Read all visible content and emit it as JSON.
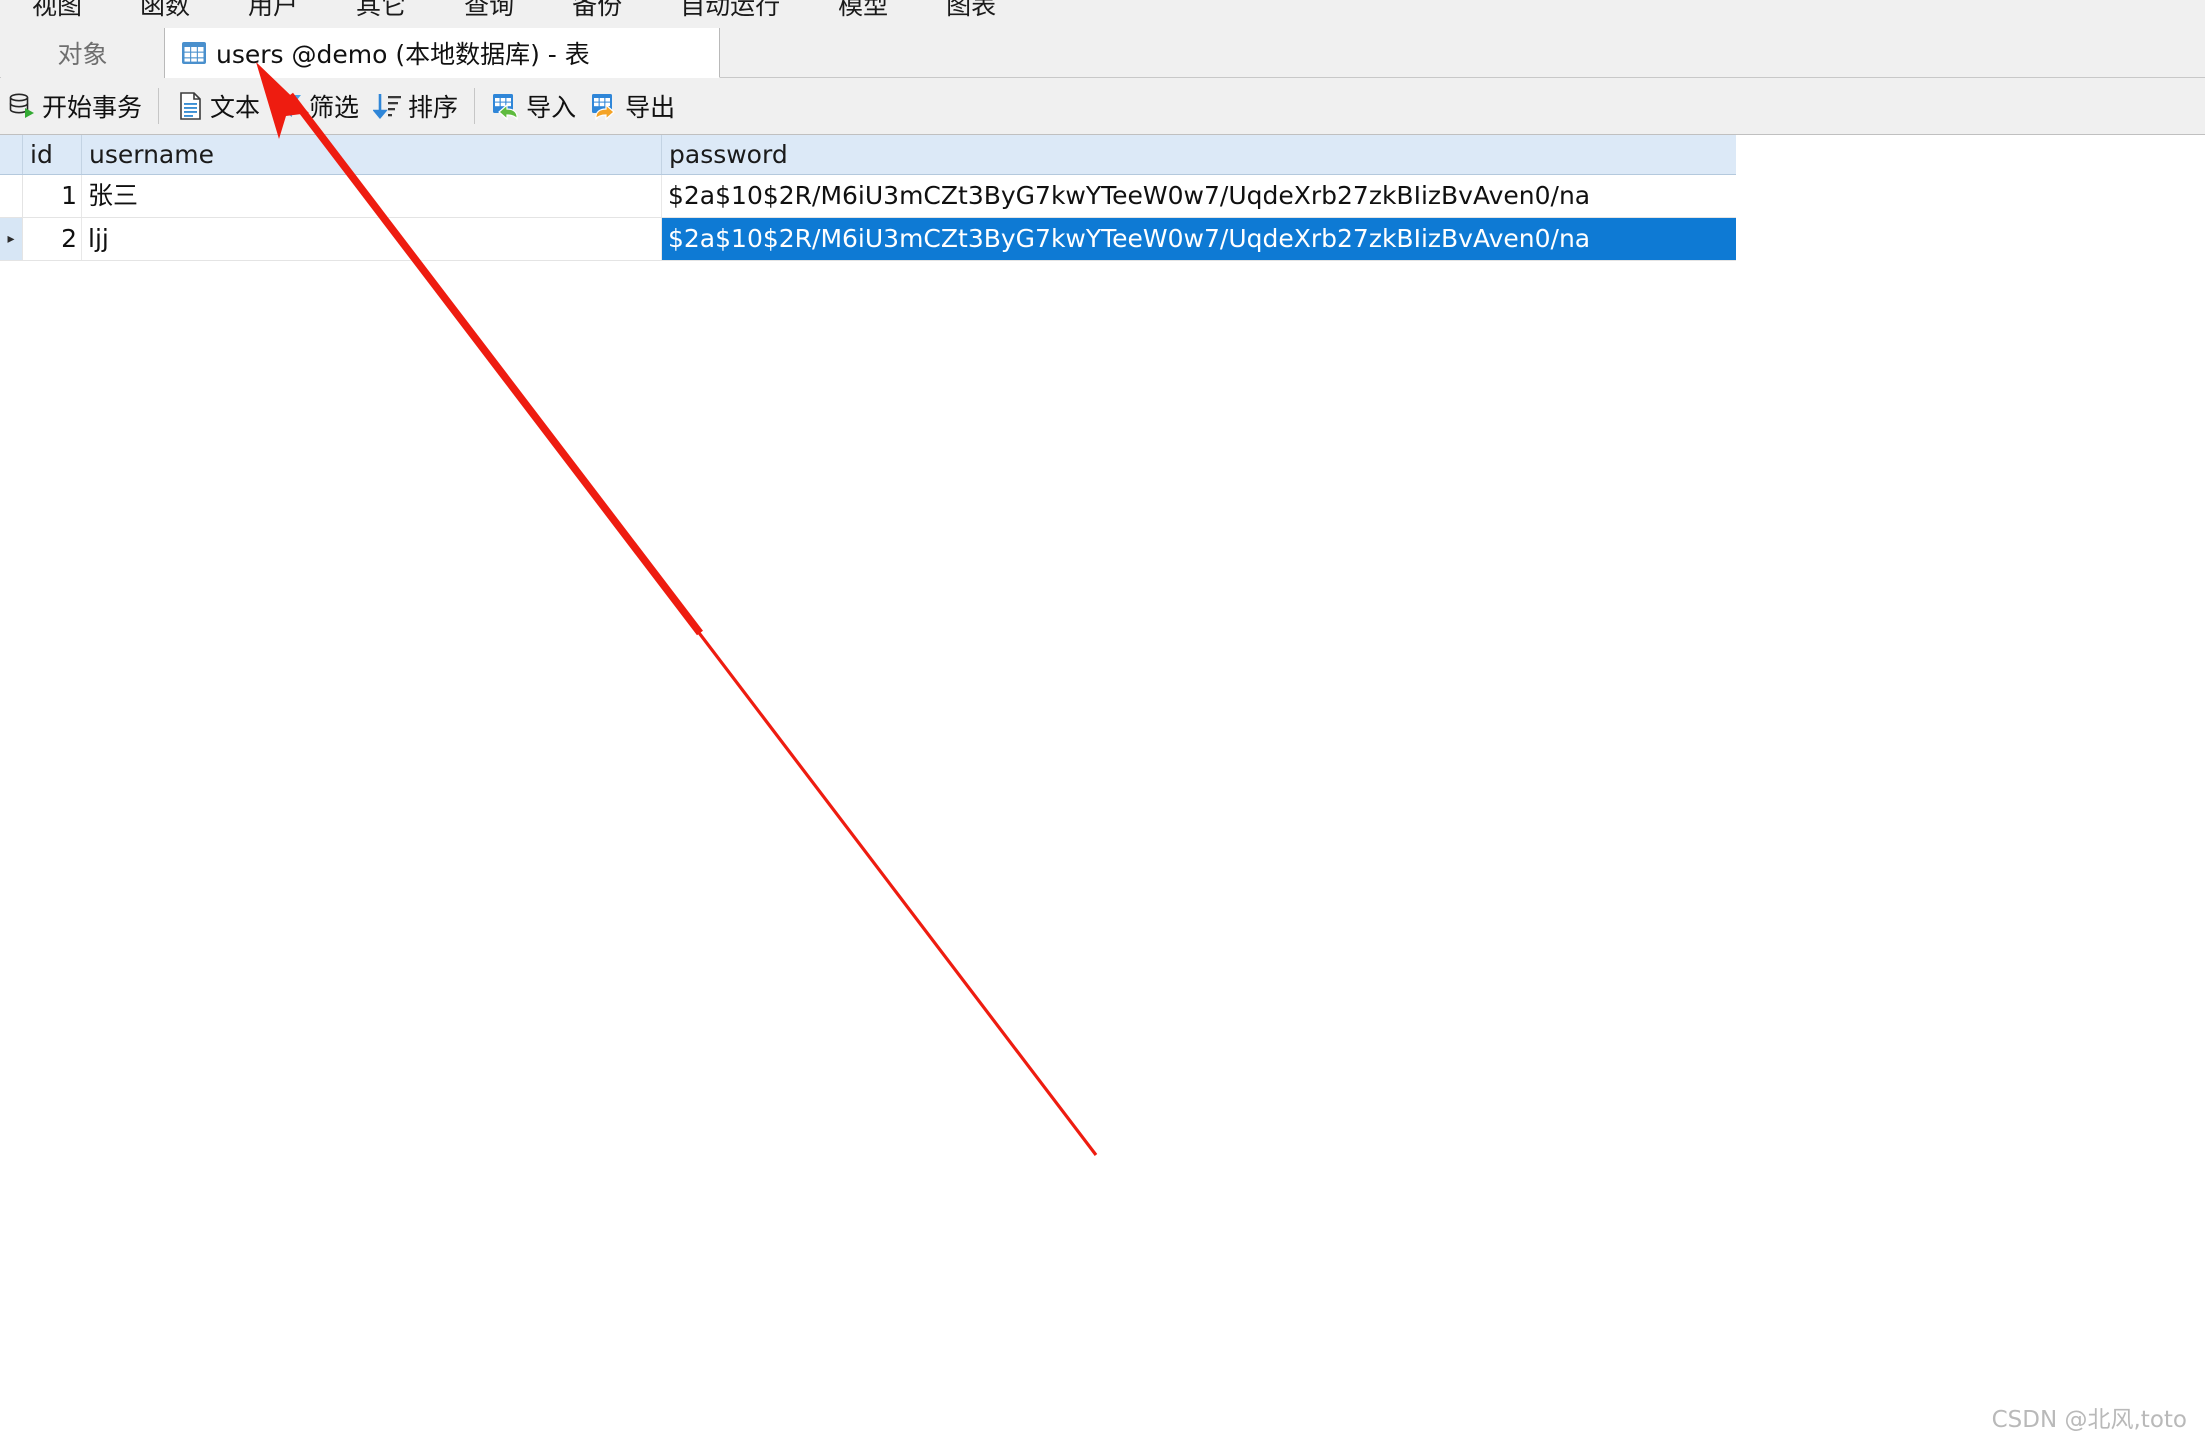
{
  "menubar": {
    "items": [
      {
        "label": "视图"
      },
      {
        "label": "函数"
      },
      {
        "label": "用户"
      },
      {
        "label": "其它"
      },
      {
        "label": "查询"
      },
      {
        "label": "备份"
      },
      {
        "label": "自动运行"
      },
      {
        "label": "模型"
      },
      {
        "label": "图表"
      }
    ]
  },
  "tabs": {
    "objects_label": "对象",
    "active_label": "users @demo (本地数据库) - 表",
    "active_icon": "table-grid-icon"
  },
  "toolbar": {
    "buttons": [
      {
        "label": "开始事务",
        "icon": "database-play-icon"
      },
      {
        "label": "文本",
        "icon": "text-document-icon"
      },
      {
        "label": "筛选",
        "icon": "filter-funnel-icon"
      },
      {
        "label": "排序",
        "icon": "sort-descending-icon"
      },
      {
        "label": "导入",
        "icon": "import-table-icon"
      },
      {
        "label": "导出",
        "icon": "export-table-icon"
      }
    ]
  },
  "grid": {
    "columns": [
      "id",
      "username",
      "password"
    ],
    "rows": [
      {
        "id": "1",
        "username": "张三",
        "password": "$2a$10$2R/M6iU3mCZt3ByG7kwYTeeW0w7/UqdeXrb27zkBIizBvAven0/na",
        "marker": "",
        "selected": false
      },
      {
        "id": "2",
        "username": "ljj",
        "password": "$2a$10$2R/M6iU3mCZt3ByG7kwYTeeW0w7/UqdeXrb27zkBIizBvAven0/na",
        "marker": "▸",
        "selected": true
      }
    ]
  },
  "annotation": {
    "color": "#ee1c10",
    "type": "arrow-pointing-to-active-tab"
  },
  "watermark": {
    "text": "CSDN @北风,toto"
  },
  "colors": {
    "selection_blue": "#0e7ad4",
    "header_blue": "#dce9f7",
    "chrome_gray": "#f0f0f0",
    "annotation_red": "#ee1c10"
  }
}
